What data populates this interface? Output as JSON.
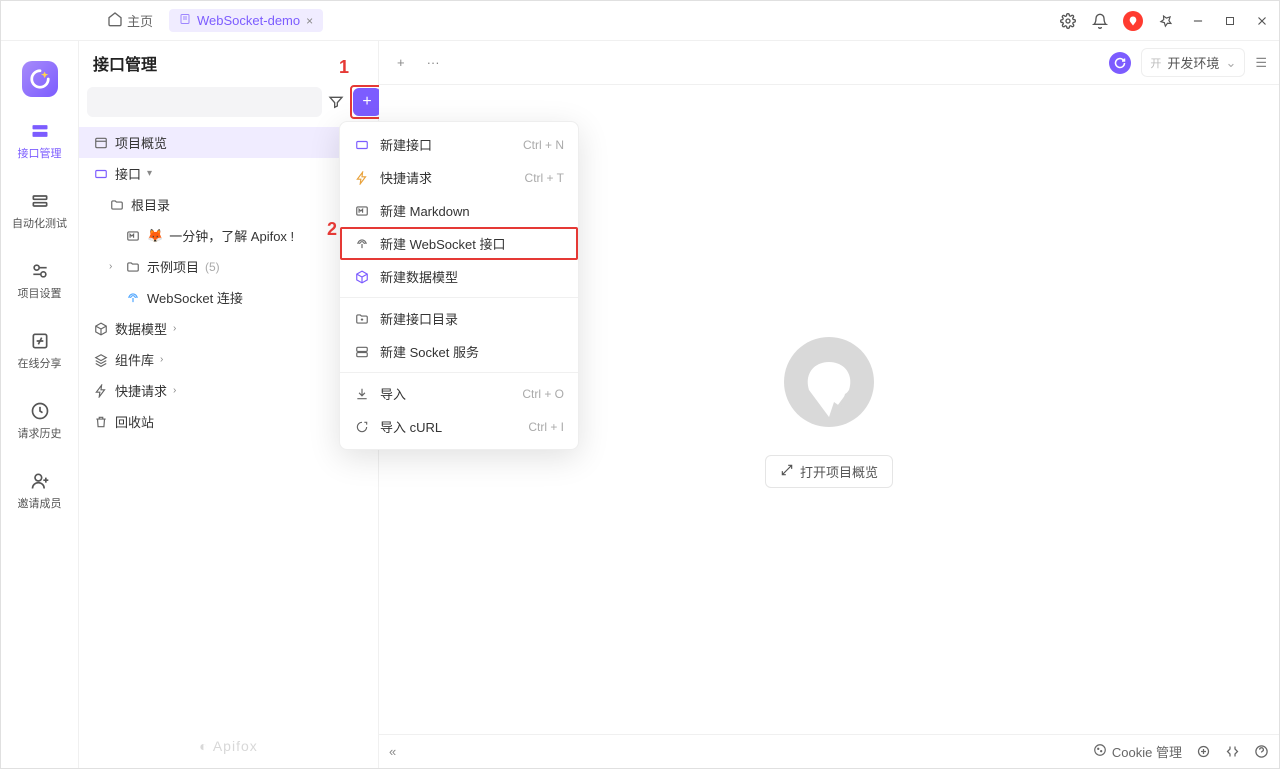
{
  "topbar": {
    "home_label": "主页",
    "tab_label": "WebSocket-demo",
    "tab_close": "×"
  },
  "nav": {
    "items": [
      {
        "label": "接口管理"
      },
      {
        "label": "自动化测试"
      },
      {
        "label": "项目设置"
      },
      {
        "label": "在线分享"
      },
      {
        "label": "请求历史"
      },
      {
        "label": "邀请成员"
      }
    ]
  },
  "left": {
    "title": "接口管理",
    "overview": "项目概览",
    "api_root": "接口",
    "folder_root": "根目录",
    "intro_doc": "一分钟，了解 Apifox !",
    "sample_folder": "示例项目",
    "sample_count": "(5)",
    "ws_conn": "WebSocket 连接",
    "data_models": "数据模型",
    "components": "组件库",
    "quick_request": "快捷请求",
    "trash": "回收站",
    "brand": "Apifox"
  },
  "dropdown": {
    "items": [
      {
        "label": "新建接口",
        "shortcut": "Ctrl + N"
      },
      {
        "label": "快捷请求",
        "shortcut": "Ctrl + T"
      },
      {
        "label": "新建 Markdown"
      },
      {
        "label": "新建 WebSocket 接口"
      },
      {
        "label": "新建数据模型"
      },
      {
        "label": "新建接口目录"
      },
      {
        "label": "新建 Socket 服务"
      },
      {
        "label": "导入",
        "shortcut": "Ctrl + O"
      },
      {
        "label": "导入 cURL",
        "shortcut": "Ctrl + I"
      }
    ]
  },
  "content": {
    "open_overview": "打开项目概览",
    "env_label": "开发环境",
    "env_prefix": "开"
  },
  "footer": {
    "cookie": "Cookie 管理"
  },
  "annotations": {
    "one": "1",
    "two": "2"
  }
}
